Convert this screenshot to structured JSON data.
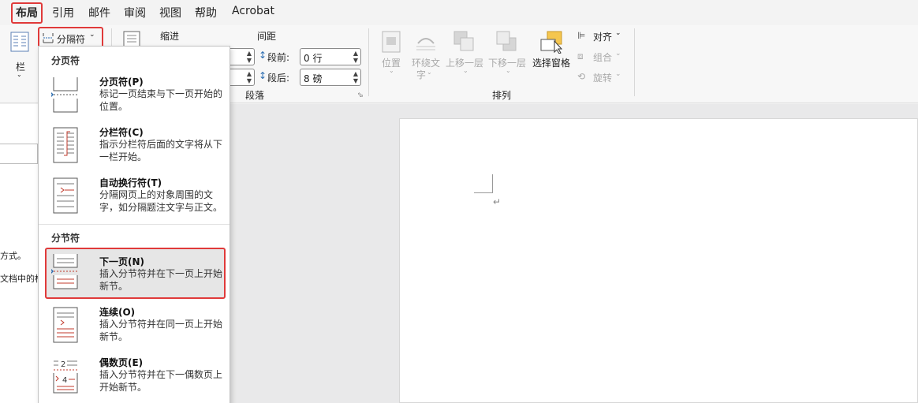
{
  "tabs": [
    "布局",
    "引用",
    "邮件",
    "审阅",
    "视图",
    "帮助",
    "Acrobat"
  ],
  "ribbon": {
    "columns_label": "栏",
    "breaks_button": "分隔符",
    "indent_label": "缩进",
    "spacing_label": "间距",
    "space_before_label": "段前:",
    "space_before_value": "0 行",
    "space_after_label": "段后:",
    "space_after_value": "8 磅",
    "paragraph_group": "段落",
    "arrange": {
      "position": "位置",
      "wrap_text_1": "环绕文",
      "wrap_text_2": "字",
      "bring_forward": "上移一层",
      "send_backward": "下移一层",
      "selection_pane": "选择窗格",
      "align": "对齐",
      "group": "组合",
      "rotate": "旋转",
      "group_label": "排列"
    }
  },
  "left_pane": {
    "text1": "方式。",
    "text2": "文档中的标"
  },
  "dropdown": {
    "page_breaks_header": "分页符",
    "section_breaks_header": "分节符",
    "items": [
      {
        "title": "分页符(P)",
        "desc": "标记一页结束与下一页开始的位置。"
      },
      {
        "title": "分栏符(C)",
        "desc": "指示分栏符后面的文字将从下一栏开始。"
      },
      {
        "title": "自动换行符(T)",
        "desc": "分隔网页上的对象周围的文字，如分隔题注文字与正文。"
      },
      {
        "title": "下一页(N)",
        "desc": "插入分节符并在下一页上开始新节。"
      },
      {
        "title": "连续(O)",
        "desc": "插入分节符并在同一页上开始新节。"
      },
      {
        "title": "偶数页(E)",
        "desc": "插入分节符并在下一偶数页上开始新节。"
      }
    ]
  },
  "document": {
    "paragraph_mark": "↵"
  },
  "colors": {
    "highlight_border": "#e03a3a",
    "break_line": "#c0392b",
    "blue_arrow": "#2b6cb0"
  }
}
